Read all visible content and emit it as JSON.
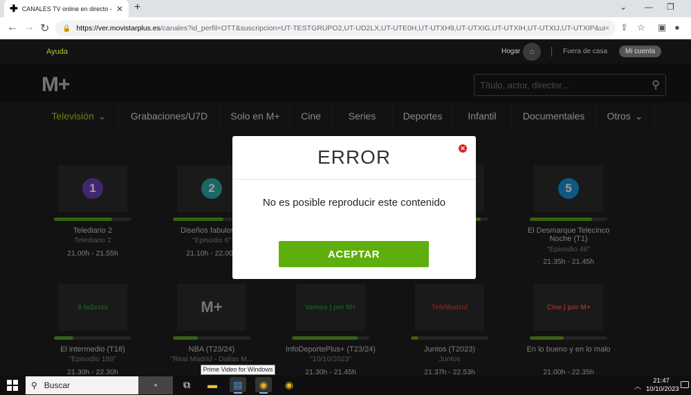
{
  "browser": {
    "tab_title": "CANALES TV online en directo - ",
    "tab_favicon": "movistar-plus-icon",
    "url_domain": "https://ver.movistarplus.es",
    "url_rest": "/canales?id_perfil=OTT&suscripcion=UT-TESTGRUPO2,UT-UD2LX,UT-UTE0H,UT-UTXH9,UT-UTXIG,UT-UTXIH,UT-UTXIJ,UT-UTXIP&ui=FICTS2&...",
    "new_tab": "+",
    "close_tab": "✕"
  },
  "utility": {
    "help": "Ayuda",
    "hogar": "Hogar",
    "fuera": "Fuera de casa",
    "account": "Mi cuenta"
  },
  "header": {
    "logo": "M+",
    "search_placeholder": "Título, actor, director..."
  },
  "menu": [
    {
      "label": "Televisión",
      "dropdown": true,
      "active": true
    },
    {
      "label": "Grabaciones/U7D"
    },
    {
      "label": "Solo en M+"
    },
    {
      "label": "Cine"
    },
    {
      "label": "Series"
    },
    {
      "label": "Deportes"
    },
    {
      "label": "Infantil"
    },
    {
      "label": "Documentales"
    },
    {
      "label": "Otros",
      "dropdown": true
    }
  ],
  "channels": [
    {
      "logo": "1",
      "logo_color": "#6a3fb5",
      "title": "Telediario 2",
      "subtitle": "Telediario 2",
      "time": "21.00h - 21.55h",
      "progress": 0.75
    },
    {
      "logo": "2",
      "logo_color": "#2aa6a0",
      "title": "Diseños fabulosos",
      "subtitle": "\"Episodio 6\"",
      "time": "21.10h - 22.00h",
      "progress": 0.65
    },
    {
      "logo": "",
      "logo_color": "#2b2b2b",
      "title": "",
      "subtitle": "",
      "time": "",
      "progress": 0.0
    },
    {
      "logo": "",
      "logo_color": "#2b2b2b",
      "title": "",
      "subtitle": "",
      "time": "",
      "progress": 0.9
    },
    {
      "logo": "5",
      "logo_color": "#1c8fd0",
      "title": "El Desmarque Telecinco Noche (T1)",
      "subtitle": "\"Episodio 46\"",
      "time": "21.35h - 21.45h",
      "progress": 0.8
    },
    {
      "logo": "6 laSexta",
      "logo_color": "#2e8b2e",
      "title": "El intermedio (T18)",
      "subtitle": "\"Episodio 189\"",
      "time": "21.30h - 22.30h",
      "progress": 0.25
    },
    {
      "logo": "M+",
      "logo_color": "#bbbbbb",
      "title": "NBA (T23/24)",
      "subtitle": "\"Real Madrid - Dallas M...",
      "time": "",
      "progress": 0.32
    },
    {
      "logo": "Vamos | por M+",
      "logo_color": "#2e8b2e",
      "title": "InfoDeportePlus+ (T23/24)",
      "subtitle": "\"10/10/2023\"",
      "time": "21.30h - 21.45h",
      "progress": 0.85
    },
    {
      "logo": "TeleMadrid",
      "logo_color": "#c0392b",
      "title": "Juntos (T2023)",
      "subtitle": "Juntos",
      "time": "21.37h - 22.53h",
      "progress": 0.1
    },
    {
      "logo": "Cine | por M+",
      "logo_color": "#d9534f",
      "title": "En lo bueno y en lo malo",
      "subtitle": "",
      "time": "21.00h - 22.35h",
      "progress": 0.44
    }
  ],
  "modal": {
    "title": "ERROR",
    "message": "No es posible reproducir este contenido",
    "button": "ACEPTAR"
  },
  "tooltip": "Prime Video for Windows",
  "taskbar": {
    "search_placeholder": "Buscar",
    "time": "21:47",
    "date": "10/10/2023"
  }
}
